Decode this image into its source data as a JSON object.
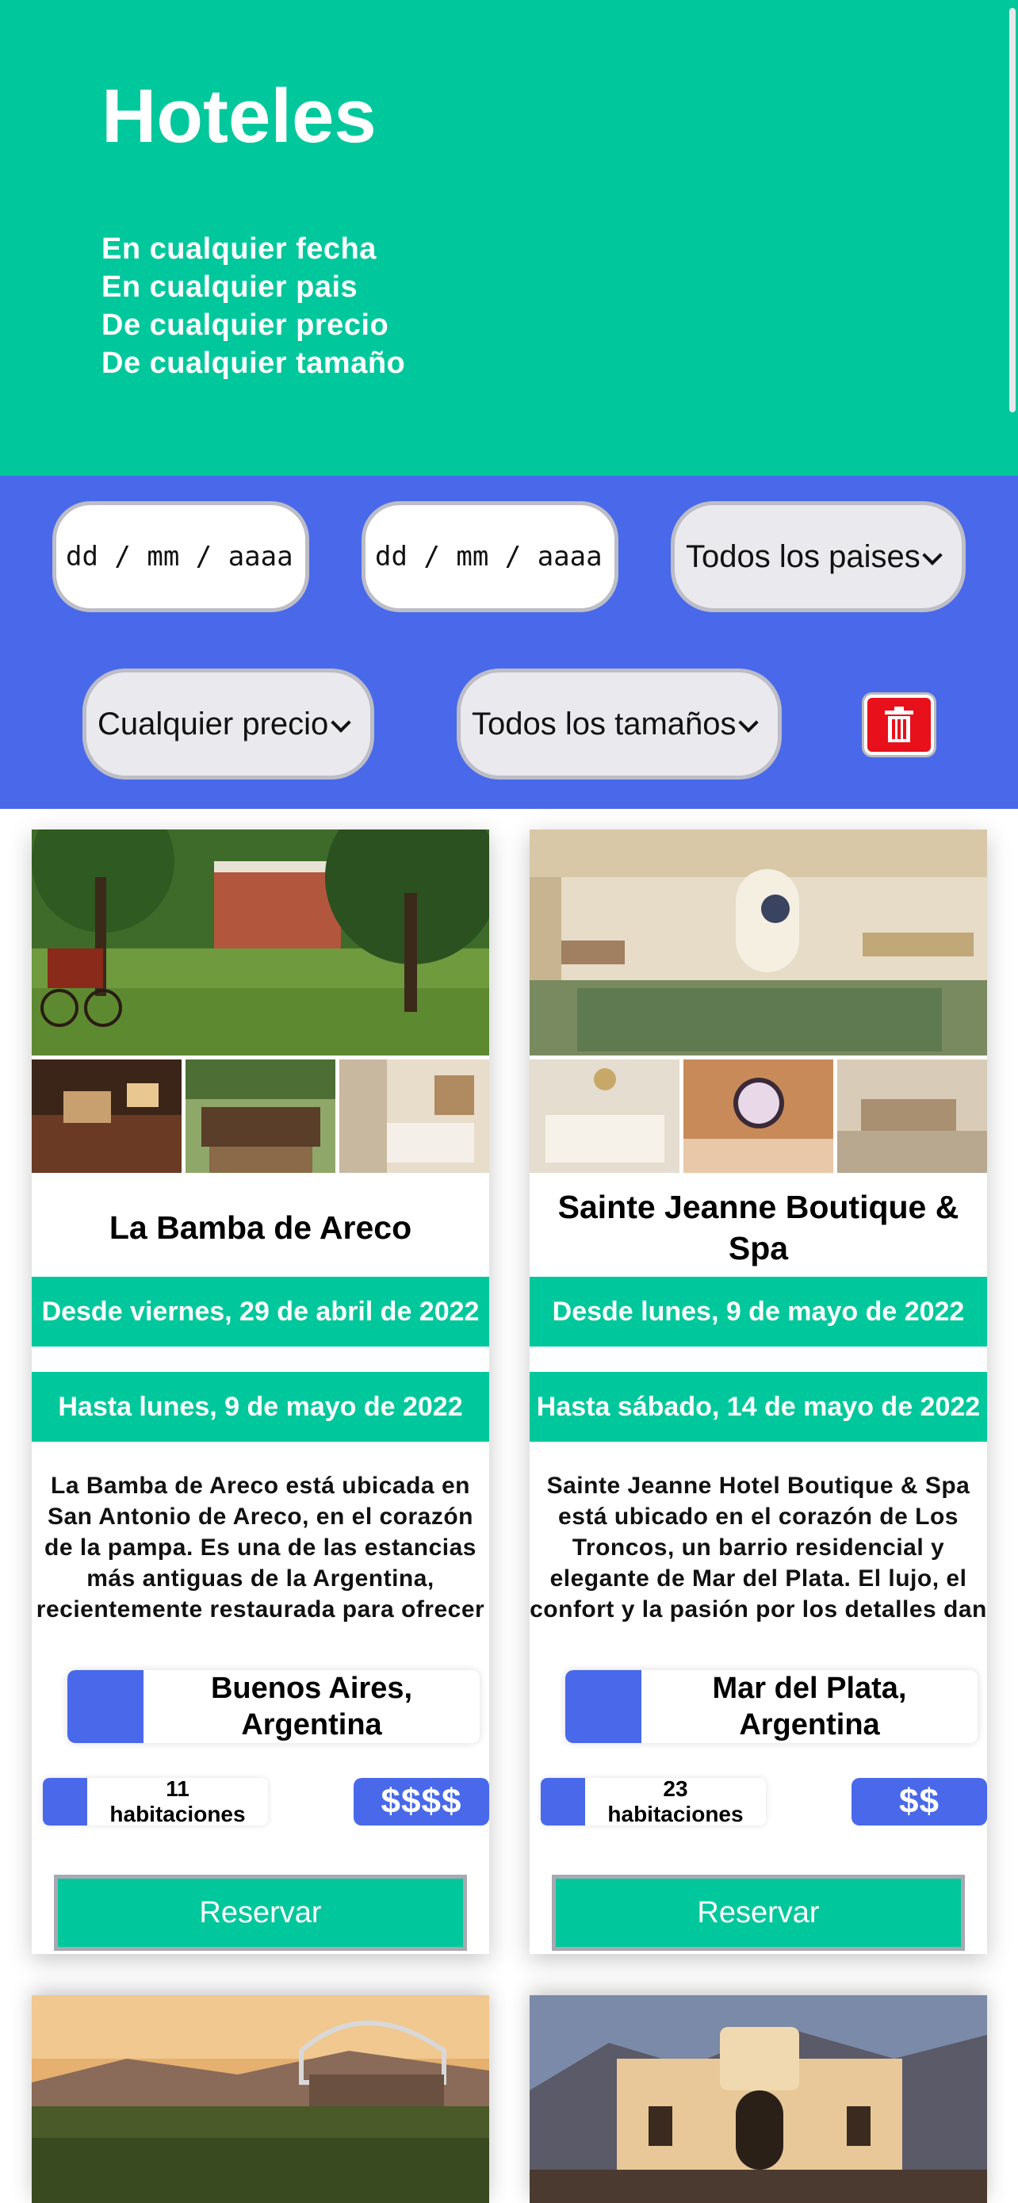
{
  "header": {
    "title": "Hoteles",
    "lines": [
      "En cualquier fecha",
      "En cualquier pais",
      "De cualquier precio",
      "De cualquier tamaño"
    ]
  },
  "filters": {
    "date_from_placeholder": "dd / mm / aaaa",
    "date_to_placeholder": "dd / mm / aaaa",
    "country": "Todos los paises",
    "price": "Cualquier precio",
    "size": "Todos los tamaños"
  },
  "hotels": [
    {
      "name": "La Bamba de Areco",
      "from": "Desde viernes, 29 de abril de 2022",
      "to": "Hasta lunes, 9 de mayo de 2022",
      "description": "La Bamba de Areco está ubicada en San Antonio de Areco, en el corazón de la pampa. Es una de las estancias más antiguas de la Argentina, recientemente restaurada para ofrecer a sus huéspedes",
      "location": "Buenos Aires, Argentina",
      "rooms_count": "11",
      "rooms_label": "habitaciones",
      "price": "$$$$",
      "button": "Reservar"
    },
    {
      "name": "Sainte Jeanne Boutique & Spa",
      "from": "Desde lunes, 9 de mayo de 2022",
      "to": "Hasta sábado, 14 de mayo de 2022",
      "description": "Sainte Jeanne Hotel Boutique & Spa está ubicado en el corazón de Los Troncos, un barrio residencial y elegante de Mar del Plata. El lujo, el confort y la pasión por los detalles dan personalidad a este",
      "location": "Mar del Plata, Argentina",
      "rooms_count": "23",
      "rooms_label": "habitaciones",
      "price": "$$",
      "button": "Reservar"
    }
  ]
}
